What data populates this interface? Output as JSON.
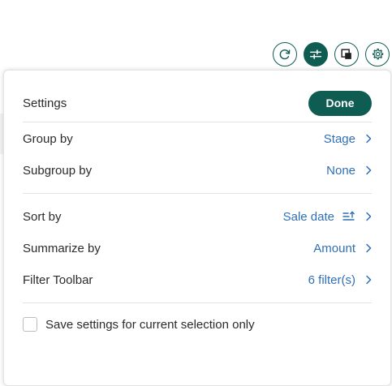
{
  "toolbar": {
    "buttons": [
      {
        "icon": "refresh-icon"
      },
      {
        "icon": "sliders-icon",
        "active": true
      },
      {
        "icon": "copy-window-icon"
      },
      {
        "icon": "gear-icon"
      }
    ]
  },
  "settings": {
    "title": "Settings",
    "done_label": "Done",
    "rows": [
      {
        "label": "Group by",
        "value": "Stage"
      },
      {
        "label": "Subgroup by",
        "value": "None"
      },
      {
        "label": "Sort by",
        "value": "Sale date",
        "icon": "sort-ascending-icon"
      },
      {
        "label": "Summarize by",
        "value": "Amount"
      },
      {
        "label": "Filter Toolbar",
        "value": "6 filter(s)"
      }
    ],
    "checkbox": {
      "label": "Save settings for current selection only",
      "checked": false
    }
  },
  "colors": {
    "accent": "#0e5c52",
    "link": "#2f6fb5"
  }
}
